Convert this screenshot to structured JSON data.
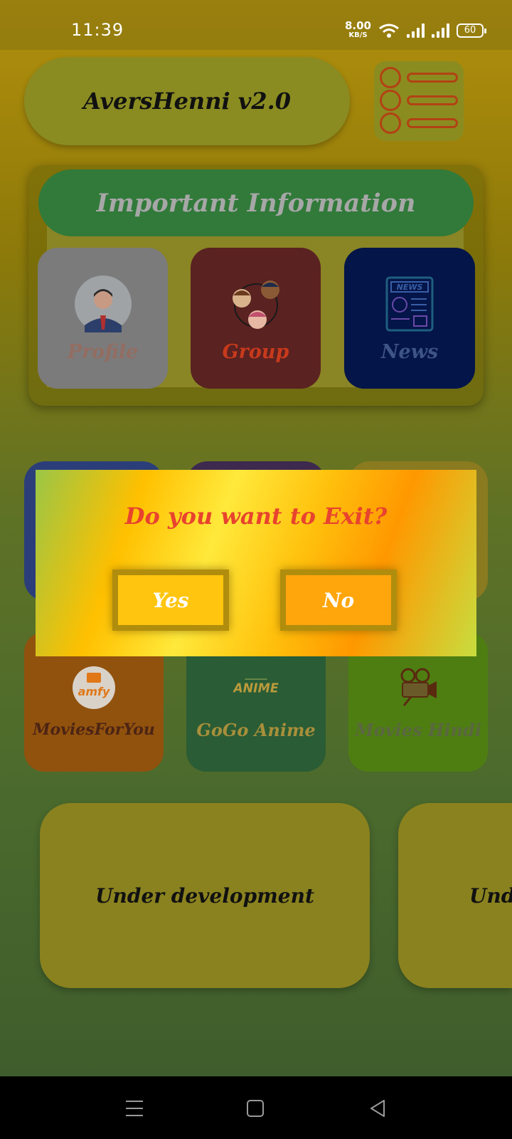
{
  "status_bar": {
    "time": "11:39",
    "net_speed_value": "8.00",
    "net_speed_unit": "KB/S",
    "battery": "60"
  },
  "header": {
    "app_title": "AversHenni v2.0",
    "menu_icon": "list-menu-icon"
  },
  "info_section": {
    "title": "Important Information",
    "tiles": [
      {
        "label": "Profile",
        "icon": "profile-avatar-icon"
      },
      {
        "label": "Group",
        "icon": "group-people-icon"
      },
      {
        "label": "News",
        "icon": "newspaper-icon"
      }
    ]
  },
  "apps": [
    {
      "label": "MoviesForYou",
      "icon": "amfy-logo-icon",
      "logo_text": "amfy"
    },
    {
      "label": "GoGo Anime",
      "icon": "gogo-anime-logo-icon",
      "logo_text": "ANIME"
    },
    {
      "label": "Movies Hindi",
      "icon": "movie-camera-icon"
    }
  ],
  "cards": [
    {
      "label": "Under development"
    },
    {
      "label": "Under development"
    }
  ],
  "dialog": {
    "question": "Do you want to Exit?",
    "yes_label": "Yes",
    "no_label": "No"
  },
  "colors": {
    "dialog_question": "#e8432e",
    "info_pill": "#317a3a",
    "group_tile": "#5a2221",
    "news_tile": "#041549"
  }
}
